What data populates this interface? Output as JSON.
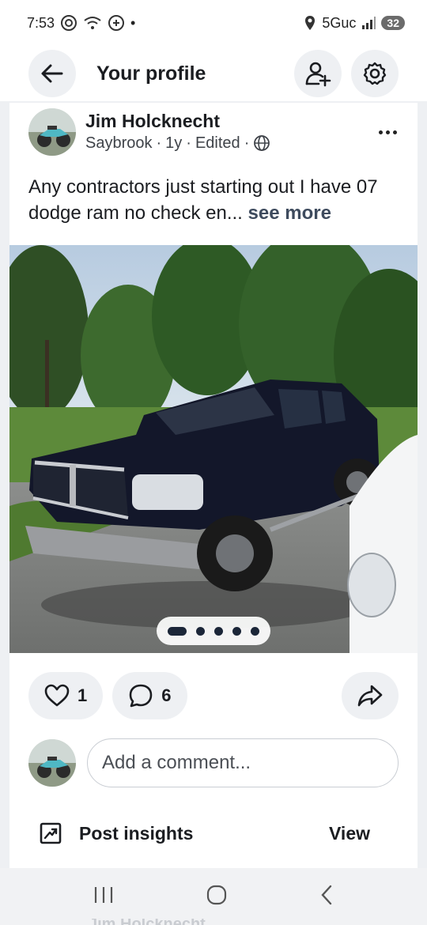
{
  "status_bar": {
    "time": "7:53",
    "dot": "•",
    "network": "5Guc",
    "battery": "32",
    "icons": [
      "mail-icon",
      "wifi-calling-icon",
      "app-icon",
      "location-icon",
      "signal-icon"
    ]
  },
  "header": {
    "title": "Your profile",
    "back_icon": "arrow-left-icon",
    "add_friend_icon": "add-user-icon",
    "settings_icon": "gear-icon"
  },
  "post": {
    "author": "Jim Holcknecht",
    "location": "Saybrook",
    "separator": "·",
    "age": "1y",
    "edited": "Edited",
    "visibility_icon": "globe-icon",
    "text": "Any contractors just starting out I have 07 dodge ram no check en...",
    "see_more": "see more",
    "photo_count": 5,
    "photo_active_index": 0,
    "reactions": {
      "likes": "1",
      "comments": "6"
    },
    "comment_placeholder": "Add a comment...",
    "insights_label": "Post insights",
    "insights_action": "View"
  },
  "next_post_author": "Jim Holcknecht",
  "colors": {
    "background": "#eef0f3",
    "card": "#ffffff",
    "text": "#1b1d21",
    "see_more": "#3e4b5e",
    "dot_active": "#1b2638"
  }
}
